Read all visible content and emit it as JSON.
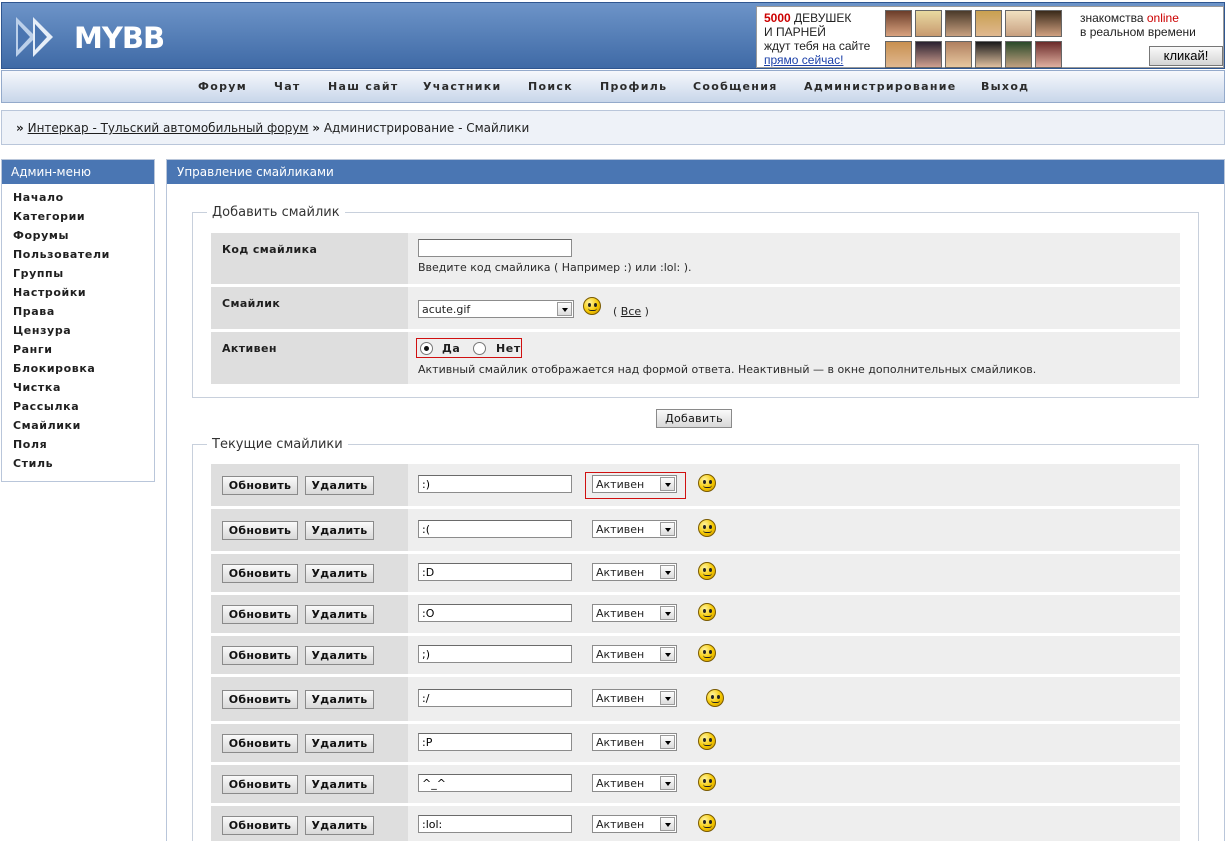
{
  "logo": {
    "text": "MYBB"
  },
  "banner": {
    "count": "5000",
    "line1_rest": " ДЕВУШЕК",
    "line2": "И ПАРНЕЙ",
    "line3": "ждут тебя на сайте",
    "link": "прямо сейчас!",
    "right_line1_a": "знакомства ",
    "right_line1_b": "online",
    "right_line2": "в реальном времени",
    "button": "кликай!"
  },
  "nav": {
    "items": [
      "Форум",
      "Чат",
      "Наш сайт",
      "Участники",
      "Поиск",
      "Профиль",
      "Сообщения",
      "Администрирование",
      "Выход"
    ]
  },
  "breadcrumb": {
    "sep1": "»",
    "forum_link": "Интеркар - Тульский автомобильный форум",
    "sep2": "»",
    "current": "Администрирование - Смайлики"
  },
  "sidebar": {
    "title": "Админ-меню",
    "items": [
      "Начало",
      "Категории",
      "Форумы",
      "Пользователи",
      "Группы",
      "Настройки",
      "Права",
      "Цензура",
      "Ранги",
      "Блокировка",
      "Чистка",
      "Рассылка",
      "Смайлики",
      "Поля",
      "Стиль"
    ]
  },
  "main": {
    "title": "Управление смайликами",
    "add": {
      "legend": "Добавить смайлик",
      "code_label": "Код смайлика",
      "code_value": "",
      "code_hint": "Введите код смайлика ( Например :) или :lol: ).",
      "image_label": "Смайлик",
      "image_value": "acute.gif",
      "all_open": "(",
      "all_link": "Все",
      "all_close": ")",
      "active_label": "Активен",
      "yes": "Да",
      "no": "Нет",
      "active_hint": "Активный смайлик отображается над формой ответа. Неактивный — в окне дополнительных смайликов.",
      "submit": "Добавить"
    },
    "current": {
      "legend": "Текущие смайлики",
      "update_label": "Обновить",
      "delete_label": "Удалить",
      "rows": [
        {
          "code": ":)",
          "status": "Активен"
        },
        {
          "code": ":(",
          "status": "Активен"
        },
        {
          "code": ":D",
          "status": "Активен"
        },
        {
          "code": ":O",
          "status": "Активен"
        },
        {
          "code": ";)",
          "status": "Активен"
        },
        {
          "code": ":/",
          "status": "Активен"
        },
        {
          "code": ":P",
          "status": "Активен"
        },
        {
          "code": "^_^",
          "status": "Активен"
        },
        {
          "code": ":lol:",
          "status": "Активен"
        }
      ]
    }
  },
  "colors": {
    "header_blue": "#4a76b3",
    "highlight_red": "#d01010"
  }
}
